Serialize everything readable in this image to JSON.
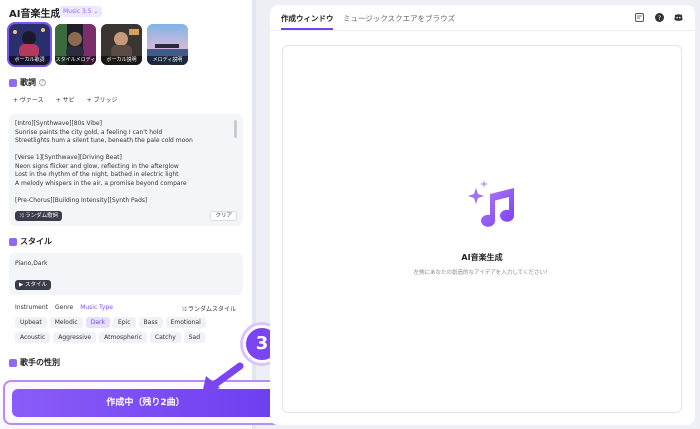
{
  "app": {
    "title": "AI音楽生成",
    "version_badge": "Music 3.5 ⌄"
  },
  "voice_tiles": [
    {
      "label": "ボーカル歌詞",
      "selected": true
    },
    {
      "label": "スタイルメロディ",
      "selected": false
    },
    {
      "label": "ボーカル説明",
      "selected": false
    },
    {
      "label": "メロディ説明",
      "selected": false
    }
  ],
  "lyrics": {
    "heading": "歌詞",
    "chips": [
      "+ ヴァース",
      "+ サビ",
      "+ ブリッジ"
    ],
    "text": "[Intro][Synthwave][80s Vibe]\nSunrise paints the city gold, a feeling I can't hold\nStreetlights hum a silent tune, beneath the pale cold moon\n\n[Verse 1][Synthwave][Driving Beat]\nNeon signs flicker and glow, reflecting in the afterglow\nLost in the rhythm of the night, bathed in electric light\nA melody whispers in the air, a promise beyond compare\n\n[Pre-Chorus][Building Intensity][Synth Pads]",
    "random_button": "⤨ ランダム歌詞",
    "clear_button": "クリア"
  },
  "style": {
    "heading": "スタイル",
    "value": "Piano,Dark",
    "style_button": "▶ スタイル",
    "tabs": [
      "Instrument",
      "Genre",
      "Music Type"
    ],
    "active_tab": "Music Type",
    "random_style": "⤨ ランダムスタイル",
    "tags": [
      {
        "label": "Upbeat",
        "selected": false
      },
      {
        "label": "Melodic",
        "selected": false
      },
      {
        "label": "Dark",
        "selected": true
      },
      {
        "label": "Epic",
        "selected": false
      },
      {
        "label": "Bass",
        "selected": false
      },
      {
        "label": "Emotional",
        "selected": false
      },
      {
        "label": "Acoustic",
        "selected": false
      },
      {
        "label": "Aggressive",
        "selected": false
      },
      {
        "label": "Atmospheric",
        "selected": false
      },
      {
        "label": "Catchy",
        "selected": false
      },
      {
        "label": "Sad",
        "selected": false
      }
    ]
  },
  "singer_gender": {
    "heading": "歌手の性別"
  },
  "generate_button": "作成中（残り2曲）",
  "step_badge": "3",
  "right_panel": {
    "tabs": [
      "作成ウィンドウ",
      "ミュージックスクエアをブラウズ"
    ],
    "active_tab": "作成ウィンドウ",
    "icons": [
      "history-icon",
      "help-icon",
      "discord-icon"
    ],
    "empty_title": "AI音楽生成",
    "empty_subtitle": "左側にあなたの創造的なアイデアを入力してください！"
  },
  "colors": {
    "accent": "#7a55f0",
    "button_gradient_start": "#8a5cf6",
    "button_gradient_end": "#6d3ef0"
  }
}
